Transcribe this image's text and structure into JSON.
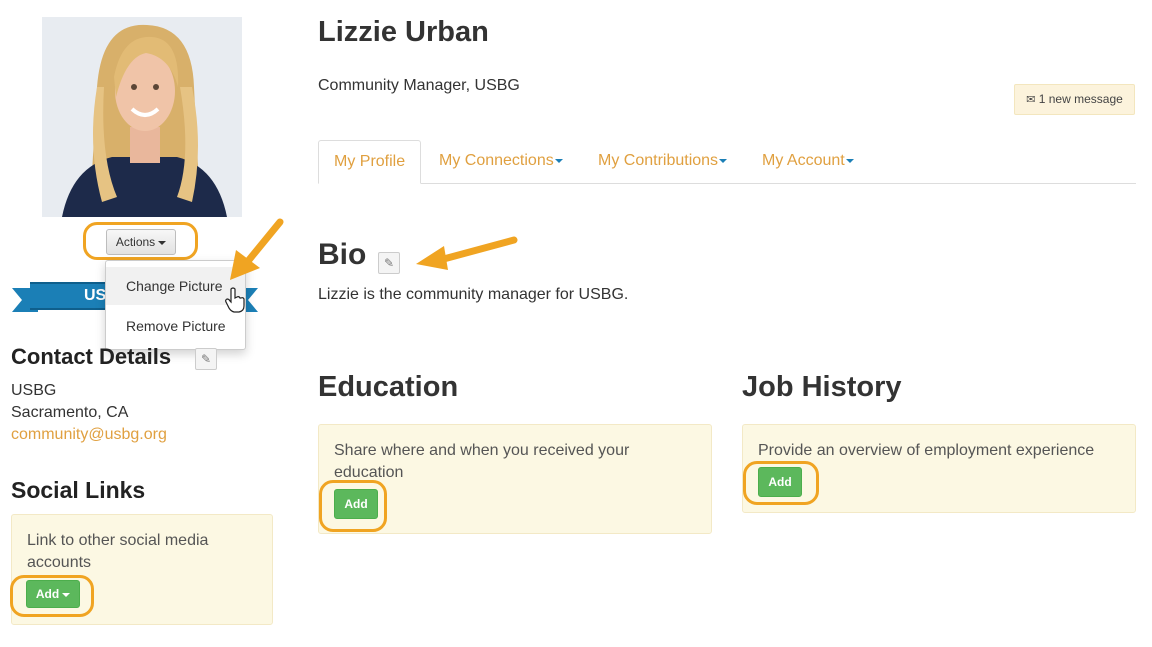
{
  "profile": {
    "name": "Lizzie Urban",
    "title": "Community Manager, USBG",
    "photo_alt": "profile photo"
  },
  "actions": {
    "label": "Actions",
    "menu": [
      "Change Picture",
      "Remove Picture"
    ]
  },
  "badge_ribbon": {
    "text": "US"
  },
  "contact": {
    "heading": "Contact Details",
    "org": "USBG",
    "location": "Sacramento, CA",
    "email": "community@usbg.org"
  },
  "social": {
    "heading": "Social Links",
    "prompt": "Link to other social media accounts",
    "add_label": "Add"
  },
  "messages": {
    "icon": "envelope-icon",
    "text": "1 new message"
  },
  "tabs": [
    {
      "label": "My Profile",
      "active": true
    },
    {
      "label": "My Connections",
      "dropdown": true
    },
    {
      "label": "My Contributions",
      "dropdown": true
    },
    {
      "label": "My Account",
      "dropdown": true
    }
  ],
  "bio": {
    "heading": "Bio",
    "text": "Lizzie is the community manager for USBG."
  },
  "education": {
    "heading": "Education",
    "prompt": "Share where and when you received your education",
    "add_label": "Add"
  },
  "job_history": {
    "heading": "Job History",
    "prompt": "Provide an overview of employment experience",
    "add_label": "Add"
  },
  "colors": {
    "accent": "#e0a040",
    "highlight": "#f0a422",
    "success": "#5cb85c",
    "ribbon": "#1b7fb6",
    "card_bg": "#fcf8e3"
  }
}
